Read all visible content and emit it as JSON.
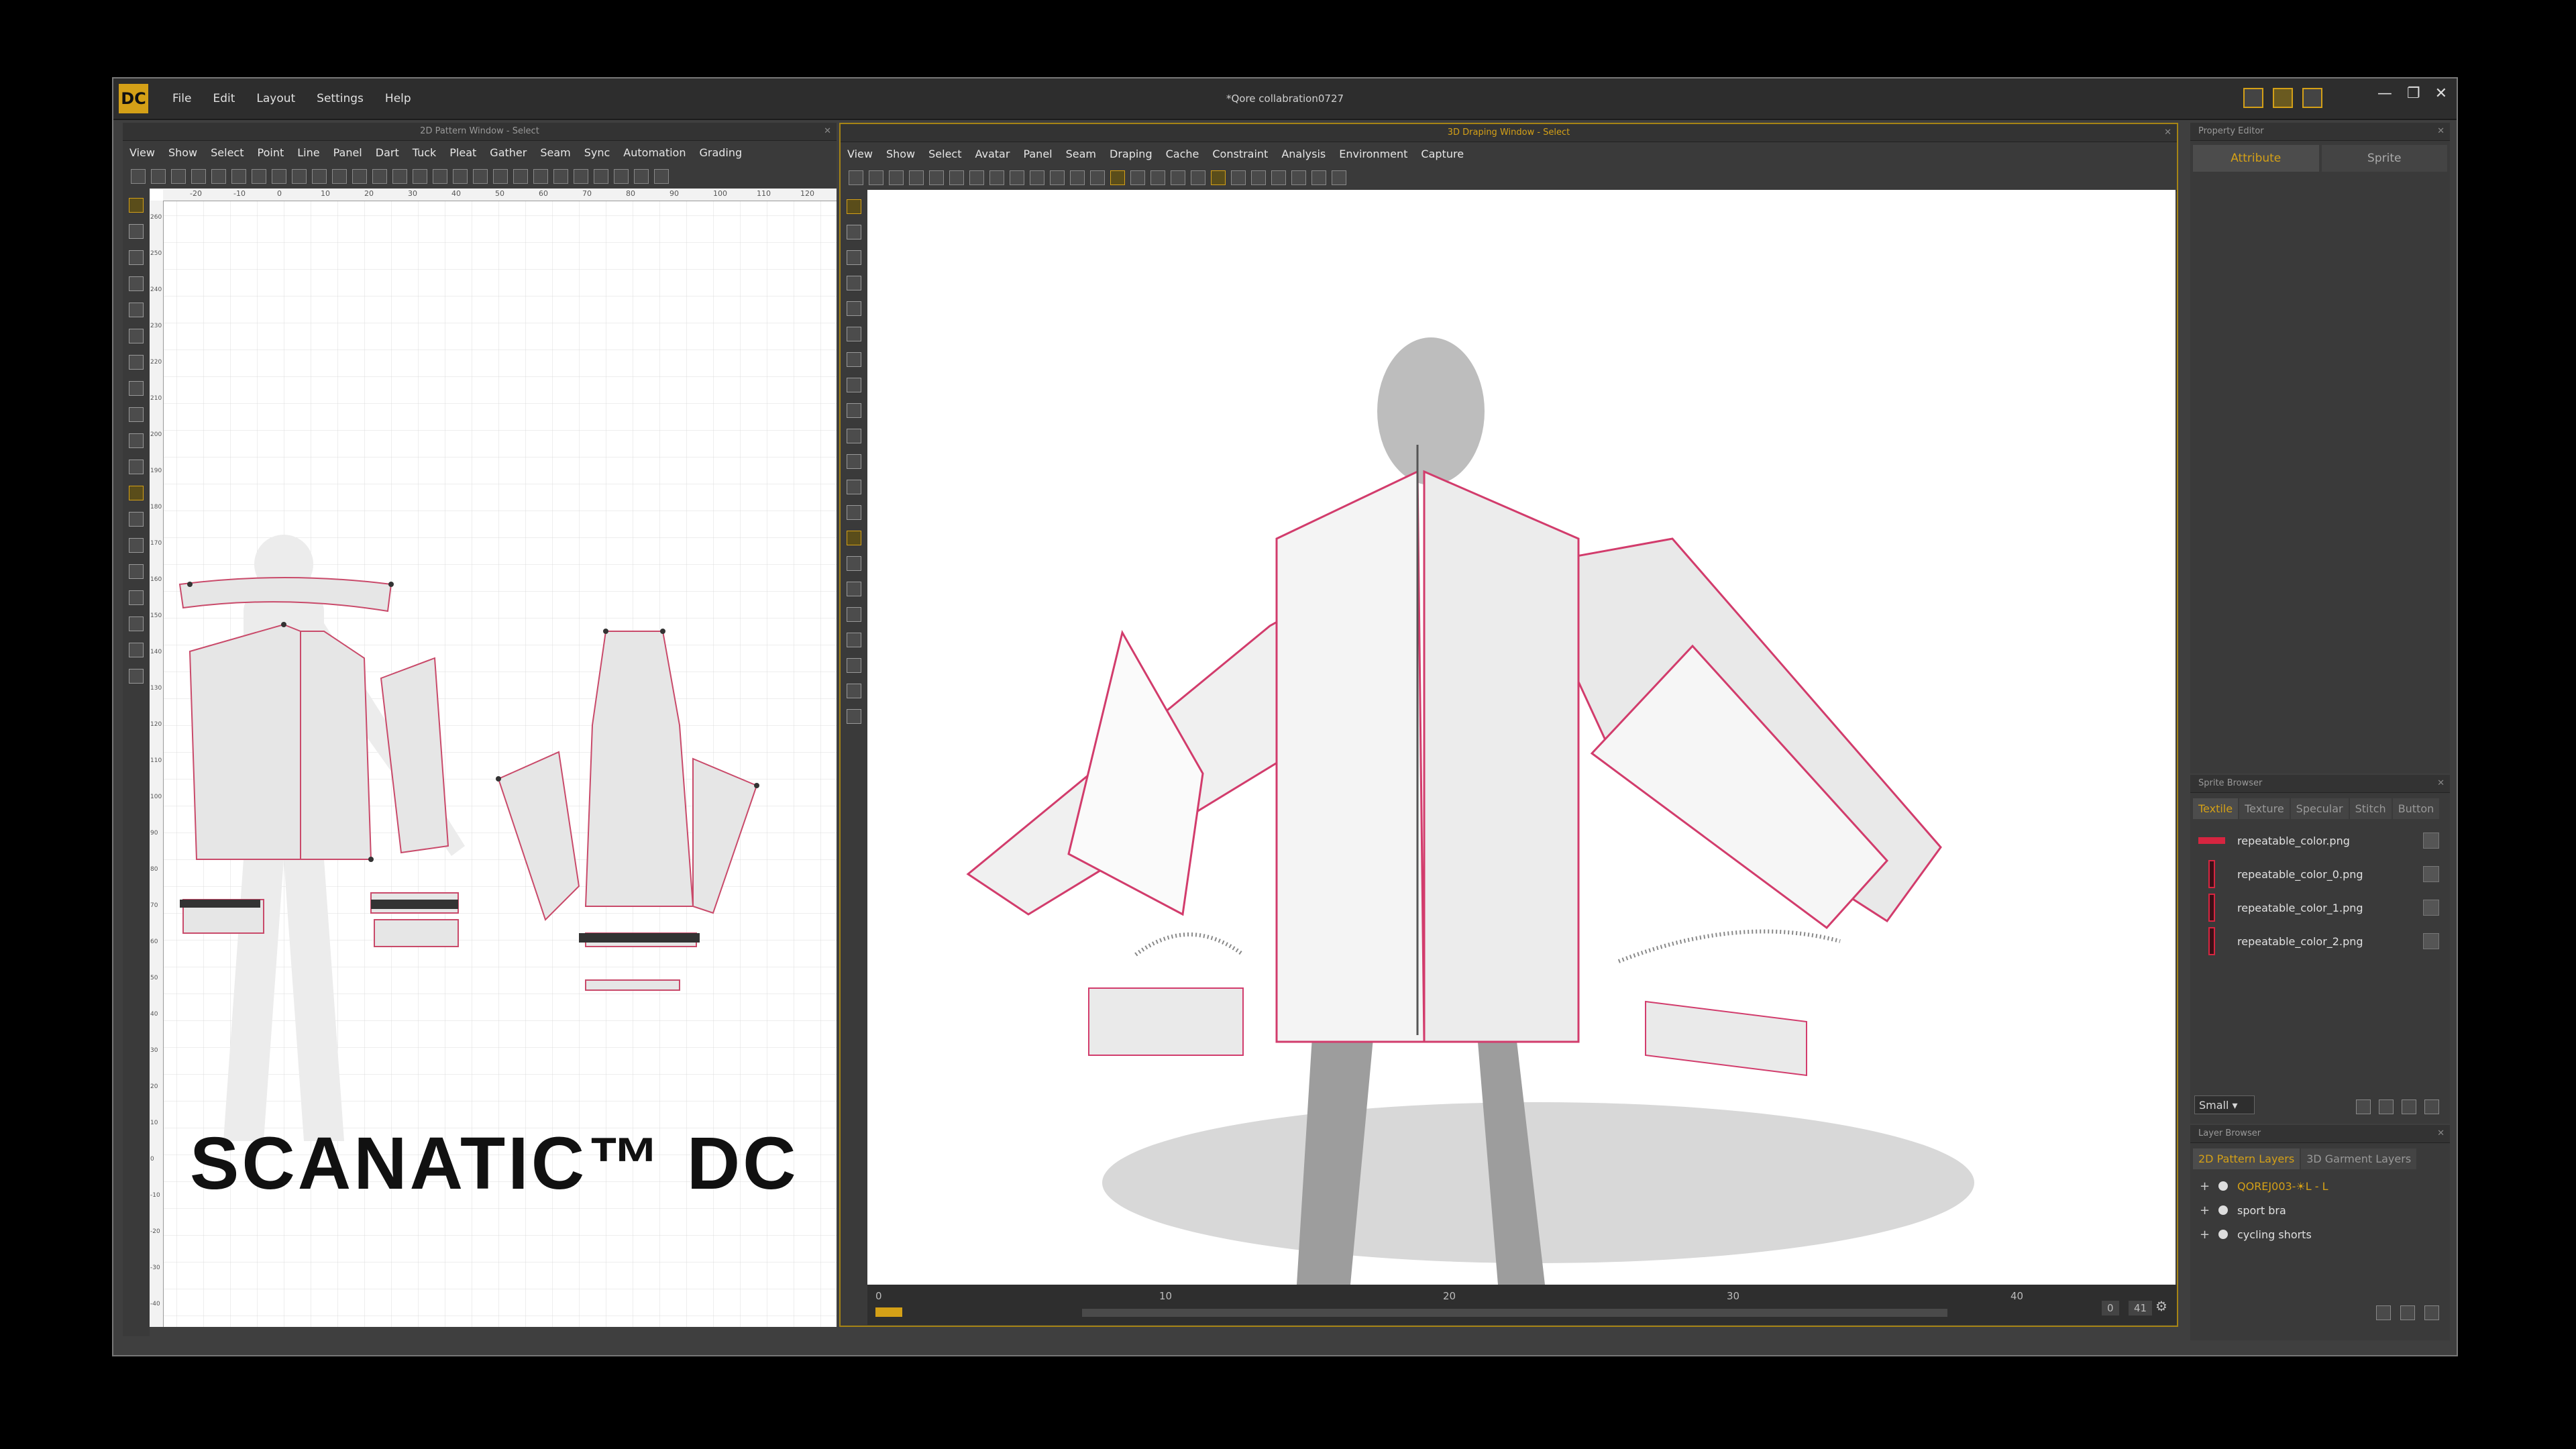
{
  "app": {
    "logo": "DC",
    "title": "*Qore collabration0727",
    "menu": [
      "File",
      "Edit",
      "Layout",
      "Settings",
      "Help"
    ],
    "window_controls": [
      "—",
      "❐",
      "✕"
    ]
  },
  "pattern_window": {
    "title": "2D Pattern Window - Select",
    "menu": [
      "View",
      "Show",
      "Select",
      "Point",
      "Line",
      "Panel",
      "Dart",
      "Tuck",
      "Pleat",
      "Gather",
      "Seam",
      "Sync",
      "Automation",
      "Grading"
    ],
    "ruler_top": [
      "-20",
      "-10",
      "0",
      "10",
      "20",
      "30",
      "40",
      "50",
      "60",
      "70",
      "80",
      "90",
      "100",
      "110",
      "120"
    ],
    "ruler_left": [
      "260",
      "250",
      "240",
      "230",
      "220",
      "210",
      "200",
      "190",
      "180",
      "170",
      "160",
      "150",
      "140",
      "130",
      "120",
      "110",
      "100",
      "90",
      "80",
      "70",
      "60",
      "50",
      "40",
      "30",
      "20",
      "10",
      "0",
      "-10",
      "-20",
      "-30",
      "-40"
    ],
    "watermark": "SCANATIC™ DC"
  },
  "draping_window": {
    "title": "3D Draping Window - Select",
    "menu": [
      "View",
      "Show",
      "Select",
      "Avatar",
      "Panel",
      "Seam",
      "Draping",
      "Cache",
      "Constraint",
      "Analysis",
      "Environment",
      "Capture"
    ],
    "timeline": {
      "ticks": [
        "0",
        "10",
        "20",
        "30",
        "40"
      ],
      "current_frame": "0",
      "end_frame": "41"
    }
  },
  "property_editor": {
    "title": "Property Editor",
    "tabs": [
      "Attribute",
      "Sprite"
    ]
  },
  "sprite_browser": {
    "title": "Sprite Browser",
    "tabs": [
      "Textile",
      "Texture",
      "Specular",
      "Stitch",
      "Button"
    ],
    "items": [
      "repeatable_color.png",
      "repeatable_color_0.png",
      "repeatable_color_1.png",
      "repeatable_color_2.png"
    ],
    "size_select": "Small",
    "accent": "#d62540"
  },
  "layer_browser": {
    "title": "Layer Browser",
    "tabs": [
      "2D Pattern Layers",
      "3D Garment Layers"
    ],
    "layers": [
      "QOREJ003-☀L - L",
      "sport bra",
      "cycling shorts"
    ]
  },
  "colors": {
    "accent": "#d4a017",
    "seam": "#e0457a"
  }
}
